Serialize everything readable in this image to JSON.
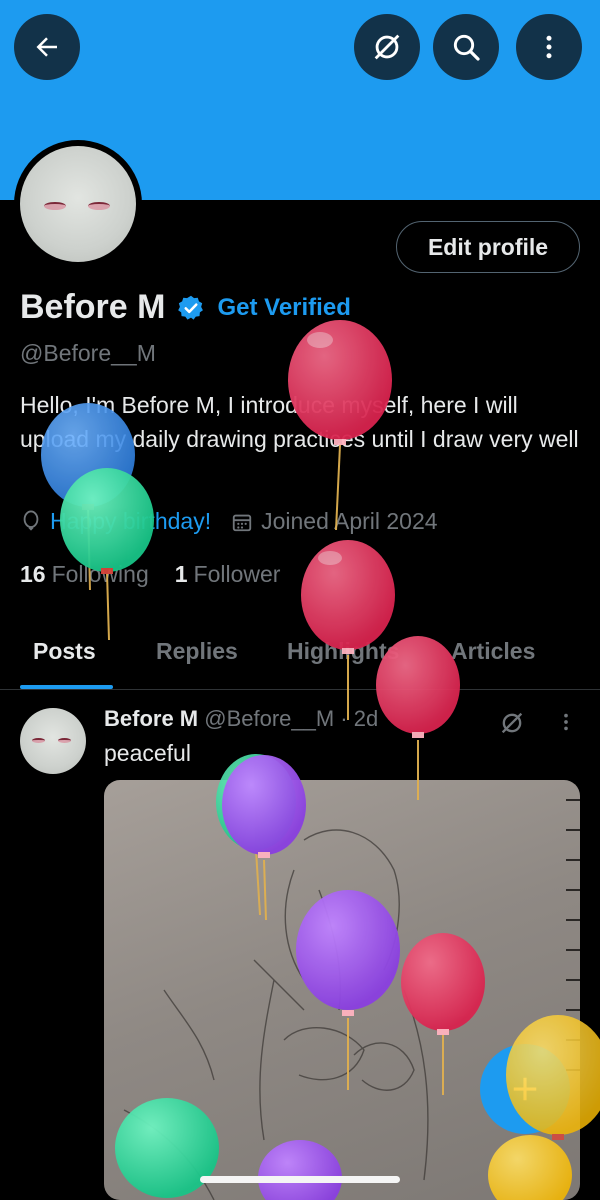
{
  "header": {
    "back_icon": "arrow-left-icon",
    "grok_icon": "grok-icon",
    "search_icon": "search-icon",
    "more_icon": "more-vertical-icon",
    "banner_color": "#1d9bf0"
  },
  "profile": {
    "edit_label": "Edit profile",
    "name": "Before M",
    "get_verified": "Get Verified",
    "handle": "@Before__M",
    "bio": "Hello, I'm Before M, I introduce myself, here I will upload my daily drawing practices until I draw very well",
    "birthday": "Happy birthday!",
    "joined": "Joined April 2024",
    "following_count": "16",
    "following_label": "Following",
    "followers_count": "1",
    "followers_label": "Follower"
  },
  "tabs": [
    {
      "label": "Posts"
    },
    {
      "label": "Replies"
    },
    {
      "label": "Highlights"
    },
    {
      "label": "Articles"
    }
  ],
  "post": {
    "author": "Before M",
    "meta": "@Before__M · 2d",
    "text": "peaceful"
  },
  "colors": {
    "accent": "#1d9bf0",
    "background": "#000000",
    "muted": "#71767b"
  }
}
